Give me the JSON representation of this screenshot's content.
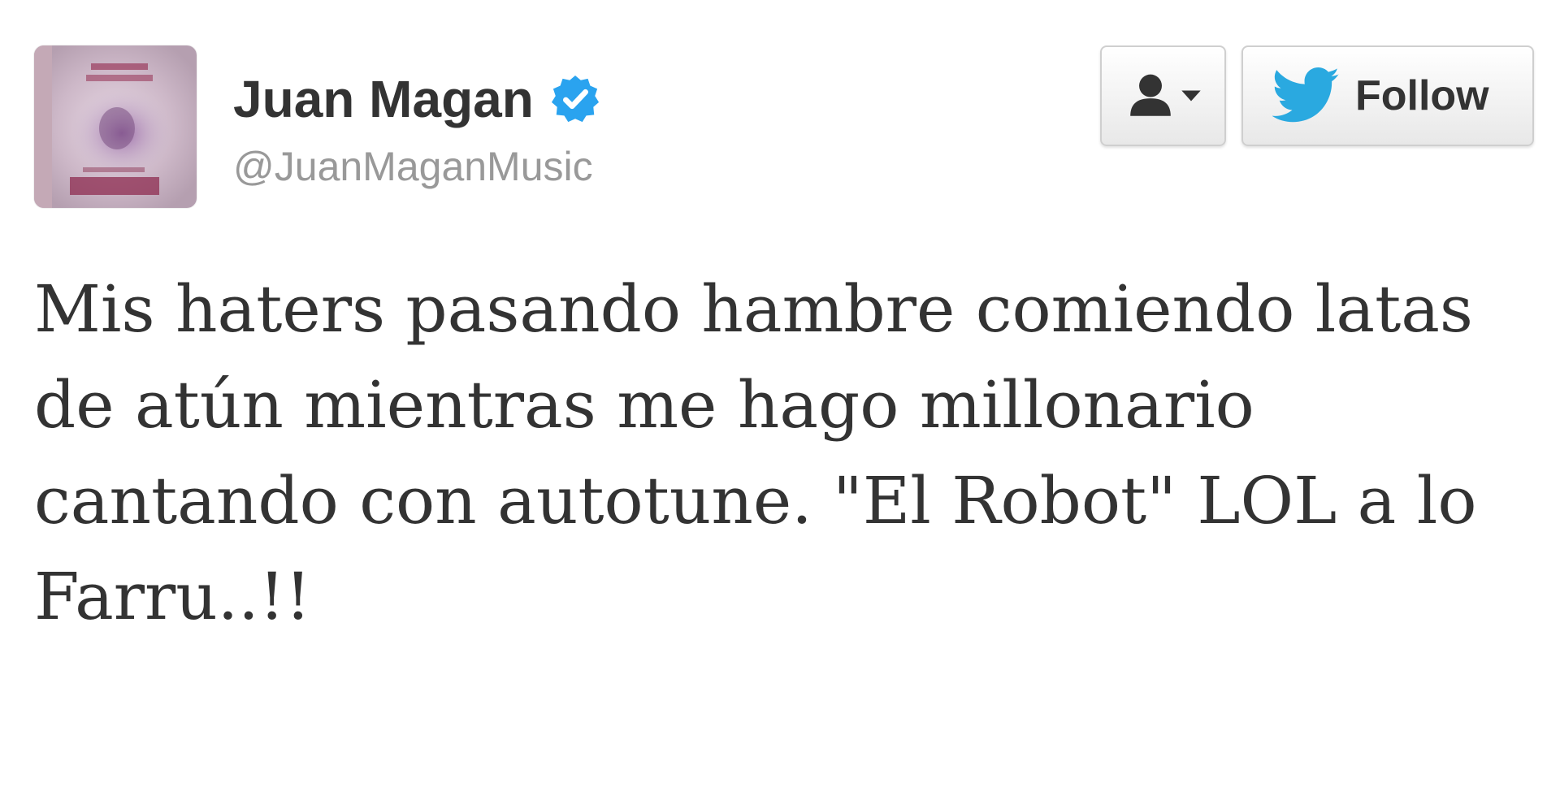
{
  "user": {
    "display_name": "Juan Magan",
    "handle": "@JuanMaganMusic",
    "verified": true,
    "avatar_icon": "album-cover-avatar"
  },
  "actions": {
    "user_menu_icon": "person-dropdown-icon",
    "follow_label": "Follow",
    "follow_icon": "twitter-bird-icon"
  },
  "tweet": {
    "text": "Mis haters pasando hambre comiendo latas de atún mientras me hago millonario cantando con autotune. \"El Robot\" LOL a lo Farru..!!"
  },
  "colors": {
    "verified_blue": "#2aa3ef",
    "twitter_blue": "#2aa9e0",
    "text": "#333333",
    "handle": "#999999"
  }
}
